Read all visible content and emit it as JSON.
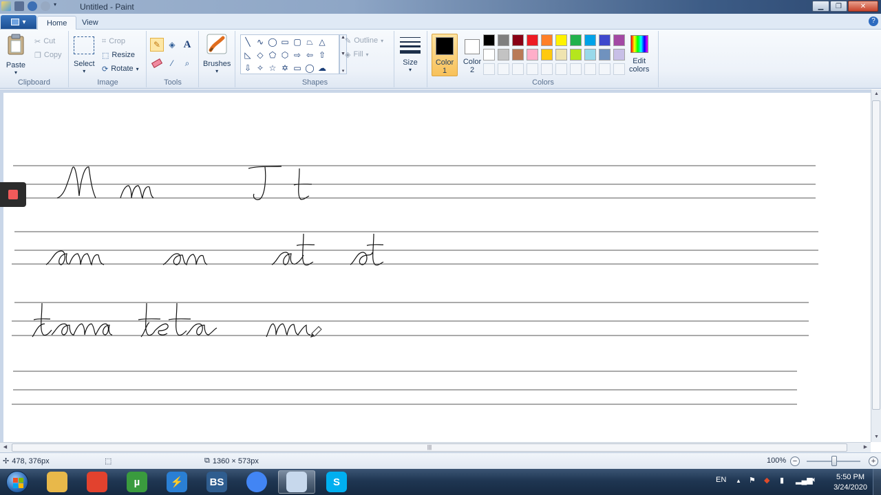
{
  "window": {
    "title": "Untitled - Paint",
    "buttons": {
      "minimize": "▁",
      "maximize": "❐",
      "close": "✕"
    }
  },
  "tabs": [
    {
      "label": "Home",
      "active": true
    },
    {
      "label": "View",
      "active": false
    }
  ],
  "help": "?",
  "clipboard": {
    "paste": "Paste",
    "cut": "Cut",
    "copy": "Copy",
    "label": "Clipboard"
  },
  "image": {
    "select": "Select",
    "crop": "Crop",
    "resize": "Resize",
    "rotate": "Rotate",
    "label": "Image"
  },
  "tools": {
    "label": "Tools",
    "text_glyph": "A"
  },
  "brushes": {
    "label": "Brushes"
  },
  "shapes": {
    "outline": "Outline",
    "fill": "Fill",
    "label": "Shapes"
  },
  "size": {
    "label": "Size"
  },
  "colors": {
    "color1_label": "Color",
    "color1_num": "1",
    "color2_label": "Color",
    "color2_num": "2",
    "edit_label": "Edit",
    "edit_label2": "colors",
    "label": "Colors",
    "color1": "#000000",
    "color2": "#ffffff",
    "palette": [
      "#000000",
      "#7f7f7f",
      "#880015",
      "#ed1c24",
      "#ff7f27",
      "#fff200",
      "#22b14c",
      "#00a2e8",
      "#3f48cc",
      "#a349a4",
      "#ffffff",
      "#c3c3c3",
      "#b97a57",
      "#ffaec9",
      "#ffc90e",
      "#efe4b0",
      "#b5e61d",
      "#99d9ea",
      "#7092be",
      "#c8bfe7"
    ]
  },
  "canvas": {
    "handwriting": [
      {
        "text": "M  m",
        "row": 1
      },
      {
        "text": "T  t",
        "row": 1
      },
      {
        "text": "am   om",
        "row": 2
      },
      {
        "text": "at  ot",
        "row": 2
      },
      {
        "text": "tama  teta",
        "row": 3
      },
      {
        "text": "mi",
        "row": 3
      }
    ]
  },
  "status": {
    "cursor_pos": "478, 376px",
    "selection_size": "",
    "image_size": "1360 × 573px",
    "zoom": "100%"
  },
  "taskbar": {
    "apps": [
      {
        "name": "explorer",
        "label": "",
        "color": "#e8b84a"
      },
      {
        "name": "recorder",
        "label": "",
        "color": "#e2422e"
      },
      {
        "name": "utorrent",
        "label": "µ",
        "color": "#3a9b3e"
      },
      {
        "name": "shareit",
        "label": "⚡",
        "color": "#2a7fd4"
      },
      {
        "name": "bs",
        "label": "BS",
        "color": "#2f5d8f"
      },
      {
        "name": "chrome",
        "label": "",
        "color": "#4285f4"
      },
      {
        "name": "paint",
        "label": "",
        "color": "#c7d8ec",
        "active": true
      },
      {
        "name": "skype",
        "label": "S",
        "color": "#00aff0"
      }
    ],
    "lang": "EN",
    "time": "5:50 PM",
    "date": "3/24/2020"
  }
}
